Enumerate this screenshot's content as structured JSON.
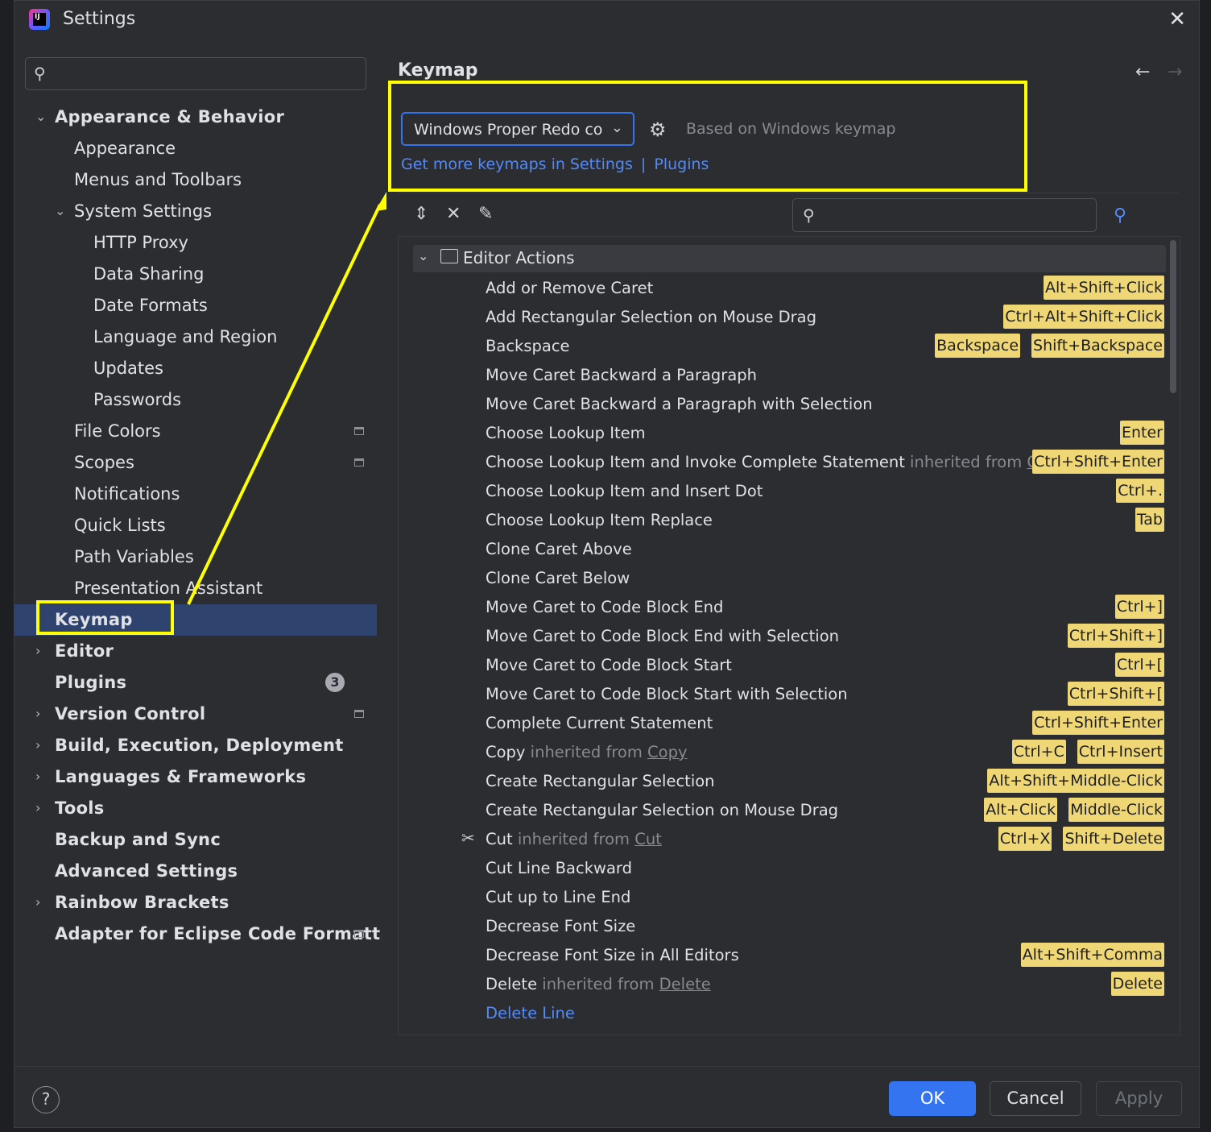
{
  "window": {
    "title": "Settings"
  },
  "sidebar": {
    "items": [
      {
        "label": "Appearance & Behavior",
        "expanded": true
      },
      {
        "label": "Appearance"
      },
      {
        "label": "Menus and Toolbars"
      },
      {
        "label": "System Settings",
        "expanded": true
      },
      {
        "label": "HTTP Proxy"
      },
      {
        "label": "Data Sharing"
      },
      {
        "label": "Date Formats"
      },
      {
        "label": "Language and Region"
      },
      {
        "label": "Updates"
      },
      {
        "label": "Passwords"
      },
      {
        "label": "File Colors"
      },
      {
        "label": "Scopes"
      },
      {
        "label": "Notifications"
      },
      {
        "label": "Quick Lists"
      },
      {
        "label": "Path Variables"
      },
      {
        "label": "Presentation Assistant"
      },
      {
        "label": "Keymap",
        "selected": true
      },
      {
        "label": "Editor"
      },
      {
        "label": "Plugins",
        "badge": "3"
      },
      {
        "label": "Version Control"
      },
      {
        "label": "Build, Execution, Deployment"
      },
      {
        "label": "Languages & Frameworks"
      },
      {
        "label": "Tools"
      },
      {
        "label": "Backup and Sync"
      },
      {
        "label": "Advanced Settings"
      },
      {
        "label": "Rainbow Brackets"
      },
      {
        "label": "Adapter for Eclipse Code Formatt"
      }
    ]
  },
  "main": {
    "title": "Keymap",
    "keymap_select": "Windows Proper Redo copy",
    "based_on": "Based on Windows keymap",
    "link_settings": "Get more keymaps in Settings",
    "link_sep": "|",
    "link_plugins": "Plugins",
    "group": "Editor Actions",
    "actions": [
      {
        "name": "Add or Remove Caret",
        "shortcuts": [
          "Alt+Shift+Click"
        ]
      },
      {
        "name": "Add Rectangular Selection on Mouse Drag",
        "shortcuts": [
          "Ctrl+Alt+Shift+Click"
        ]
      },
      {
        "name": "Backspace",
        "shortcuts": [
          "Backspace",
          "Shift+Backspace"
        ]
      },
      {
        "name": "Move Caret Backward a Paragraph",
        "shortcuts": []
      },
      {
        "name": "Move Caret Backward a Paragraph with Selection",
        "shortcuts": []
      },
      {
        "name": "Choose Lookup Item",
        "shortcuts": [
          "Enter"
        ]
      },
      {
        "name": "Choose Lookup Item and Invoke Complete Statement",
        "inherited_prefix": "inherited from",
        "inherited": "Comple",
        "shortcuts": [
          "Ctrl+Shift+Enter"
        ]
      },
      {
        "name": "Choose Lookup Item and Insert Dot",
        "shortcuts": [
          "Ctrl+."
        ]
      },
      {
        "name": "Choose Lookup Item Replace",
        "shortcuts": [
          "Tab"
        ]
      },
      {
        "name": "Clone Caret Above",
        "shortcuts": []
      },
      {
        "name": "Clone Caret Below",
        "shortcuts": []
      },
      {
        "name": "Move Caret to Code Block End",
        "shortcuts": [
          "Ctrl+]"
        ]
      },
      {
        "name": "Move Caret to Code Block End with Selection",
        "shortcuts": [
          "Ctrl+Shift+]"
        ]
      },
      {
        "name": "Move Caret to Code Block Start",
        "shortcuts": [
          "Ctrl+["
        ]
      },
      {
        "name": "Move Caret to Code Block Start with Selection",
        "shortcuts": [
          "Ctrl+Shift+["
        ]
      },
      {
        "name": "Complete Current Statement",
        "shortcuts": [
          "Ctrl+Shift+Enter"
        ]
      },
      {
        "name": "Copy",
        "inherited_prefix": "inherited from",
        "inherited": "Copy",
        "shortcuts": [
          "Ctrl+C",
          "Ctrl+Insert"
        ]
      },
      {
        "name": "Create Rectangular Selection",
        "shortcuts": [
          "Alt+Shift+Middle-Click"
        ]
      },
      {
        "name": "Create Rectangular Selection on Mouse Drag",
        "shortcuts": [
          "Alt+Click",
          "Middle-Click"
        ]
      },
      {
        "name": "Cut",
        "inherited_prefix": "inherited from",
        "inherited": "Cut",
        "icon": "scissors-icon",
        "shortcuts": [
          "Ctrl+X",
          "Shift+Delete"
        ]
      },
      {
        "name": "Cut Line Backward",
        "shortcuts": []
      },
      {
        "name": "Cut up to Line End",
        "shortcuts": []
      },
      {
        "name": "Decrease Font Size",
        "shortcuts": []
      },
      {
        "name": "Decrease Font Size in All Editors",
        "shortcuts": [
          "Alt+Shift+Comma"
        ]
      },
      {
        "name": "Delete",
        "inherited_prefix": "inherited from",
        "inherited": "Delete",
        "shortcuts": [
          "Delete"
        ]
      },
      {
        "name": "Delete Line",
        "link": true,
        "shortcuts": []
      }
    ]
  },
  "footer": {
    "ok": "OK",
    "cancel": "Cancel",
    "apply": "Apply",
    "help": "?"
  },
  "colors": {
    "accent": "#3574f0",
    "highlight": "#ffff00",
    "shortcut_bg": "#f0d775",
    "selection": "#2e436e"
  }
}
